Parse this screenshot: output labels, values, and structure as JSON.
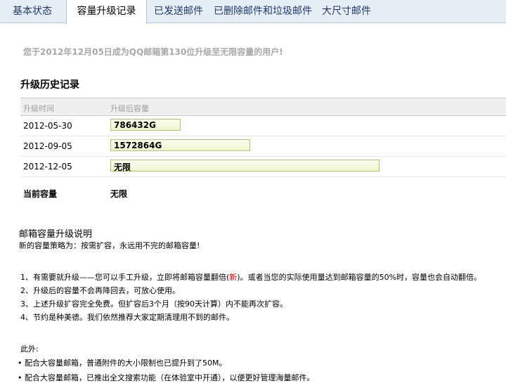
{
  "tabs": [
    {
      "label": "基本状态",
      "active": false
    },
    {
      "label": "容量升级记录",
      "active": true
    },
    {
      "label": "已发送邮件",
      "active": false
    },
    {
      "label": "已删除邮件和垃圾邮件",
      "active": false
    },
    {
      "label": "大尺寸邮件",
      "active": false
    }
  ],
  "notice": "您于2012年12月05日成为QQ邮箱第130位升级至无限容量的用户!",
  "history": {
    "title": "升级历史记录",
    "col_time": "升级时间",
    "col_capacity": "升级后容量",
    "rows": [
      {
        "date": "2012-05-30",
        "capacity": "786432G",
        "fill": 0.26
      },
      {
        "date": "2012-09-05",
        "capacity": "1572864G",
        "fill": 0.52
      },
      {
        "date": "2012-12-05",
        "capacity": "无限",
        "fill": 1.0
      }
    ],
    "current_label": "当前容量",
    "current_value": "无限"
  },
  "description": {
    "title": "邮箱容量升级说明",
    "subtitle": "新的容量策略为：按需扩容，永远用不完的邮箱容量!",
    "rules": [
      {
        "before": "1、有需要就升级——您可以手工升级，立即将邮箱容量翻倍(",
        "highlight": "新",
        "after": ")。或者当您的实际使用量达到邮箱容量的50%时，容量也会自动翻倍。"
      },
      {
        "before": "2、升级后的容量不会再降回去，可放心使用。",
        "highlight": "",
        "after": ""
      },
      {
        "before": "3、上述升级扩容完全免费。但扩容后3个月（按90天计算）内不能再次扩容。",
        "highlight": "",
        "after": ""
      },
      {
        "before": "4、节约是种美德。我们依然推荐大家定期清理用不到的邮件。",
        "highlight": "",
        "after": ""
      }
    ],
    "also_label": "此外:",
    "bullets": [
      "• 配合大容量邮箱，普通附件的大小限制也已提升到了50M。",
      "• 配合大容量邮箱，已推出全文搜索功能（在体验室中开通），以便更好管理海量邮件。"
    ]
  },
  "colors": {
    "tabbar_bg": "#e7edf5",
    "tab_text": "#1f3a6a",
    "bar_border": "#b3bf7a",
    "highlight_red": "#cc0000"
  }
}
